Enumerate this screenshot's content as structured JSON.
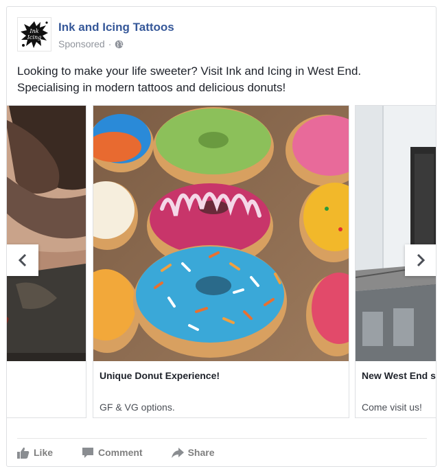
{
  "post": {
    "page_name": "Ink and Icing Tattoos",
    "sponsored_label": "Sponsored",
    "separator": "·",
    "text_line1": "Looking to make your life sweeter? Visit Ink and Icing in West End.",
    "text_line2": "Specialising in modern tattoos and delicious donuts!"
  },
  "carousel": {
    "cards": [
      {
        "image": "tattooed-man-photo",
        "title": "",
        "description": ""
      },
      {
        "image": "colorful-donuts-photo",
        "title": "Unique Donut Experience!",
        "description": "GF & VG options."
      },
      {
        "image": "west-end-building-photo",
        "title": "New West End store!",
        "description": "Come visit us!"
      }
    ],
    "prev_icon": "chevron-left-icon",
    "next_icon": "chevron-right-icon"
  },
  "actions": {
    "like_label": "Like",
    "comment_label": "Comment",
    "share_label": "Share"
  },
  "colors": {
    "page_name": "#365899",
    "text": "#1d2129",
    "muted": "#90949c",
    "action": "#7f7f7f",
    "border": "#dddfe2"
  }
}
